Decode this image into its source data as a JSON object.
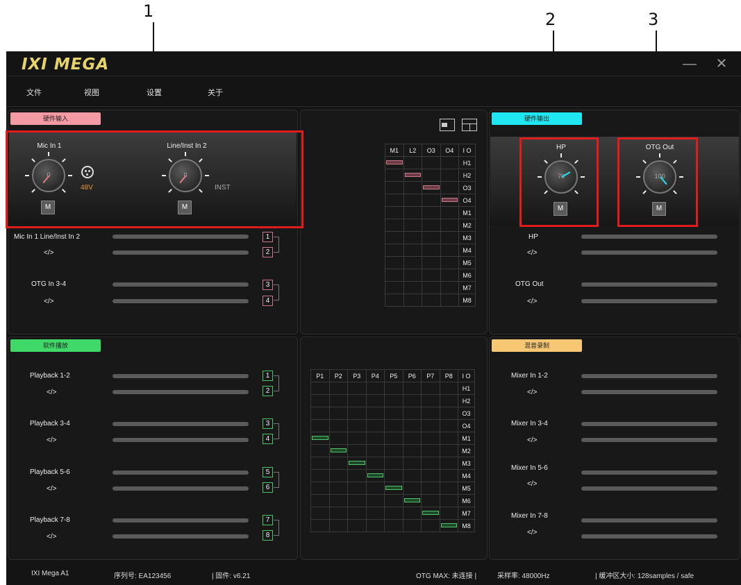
{
  "callouts": [
    "1",
    "2",
    "3"
  ],
  "app": {
    "logo": "IXI MEGA",
    "minimize": "—",
    "close": "✕"
  },
  "menu": {
    "file": "文件",
    "view": "视图",
    "settings": "设置",
    "about": "关于"
  },
  "hw_input": {
    "tag": "硬件输入",
    "tag_color": "#f49aa4",
    "mic": {
      "label": "Mic In 1",
      "value": "0",
      "phantom": "48V"
    },
    "line": {
      "label": "Line/Inst In 2",
      "value": "0",
      "inst": "INST"
    },
    "mute": "M",
    "rows": [
      {
        "name": "Mic In 1  Line/Inst In 2",
        "code": "</>",
        "nums": [
          "1",
          "2"
        ]
      },
      {
        "name": "OTG In 3-4",
        "code": "</>",
        "nums": [
          "3",
          "4"
        ]
      }
    ]
  },
  "hw_output": {
    "tag": "硬件输出",
    "tag_color": "#1fe6f0",
    "hp": {
      "label": "HP",
      "value": "70"
    },
    "otg": {
      "label": "OTG Out",
      "value": "100"
    },
    "mute": "M",
    "rows": [
      {
        "name": "HP",
        "code": "</>"
      },
      {
        "name": "OTG Out",
        "code": "</>"
      }
    ]
  },
  "sw_playback": {
    "tag": "软件播放",
    "tag_color": "#3fd96a",
    "rows": [
      {
        "name": "Playback 1-2",
        "code": "</>",
        "nums": [
          "1",
          "2"
        ]
      },
      {
        "name": "Playback 3-4",
        "code": "</>",
        "nums": [
          "3",
          "4"
        ]
      },
      {
        "name": "Playback 5-6",
        "code": "</>",
        "nums": [
          "5",
          "6"
        ]
      },
      {
        "name": "Playback 7-8",
        "code": "</>",
        "nums": [
          "7",
          "8"
        ]
      }
    ]
  },
  "mix_record": {
    "tag": "混音录制",
    "tag_color": "#f7c774",
    "rows": [
      {
        "name": "Mixer In 1-2",
        "code": "</>"
      },
      {
        "name": "Mixer In 3-4",
        "code": "</>"
      },
      {
        "name": "Mixer In 5-6",
        "code": "</>"
      },
      {
        "name": "Mixer In 7-8",
        "code": "</>"
      }
    ]
  },
  "matrix_top": {
    "cols": [
      "M1",
      "L2",
      "O3",
      "O4"
    ],
    "corner": "I O",
    "rows": [
      "H1",
      "H2",
      "O3",
      "O4",
      "M1",
      "M2",
      "M3",
      "M4",
      "M5",
      "M6",
      "M7",
      "M8"
    ],
    "routes": [
      [
        0,
        0
      ],
      [
        1,
        1
      ],
      [
        2,
        2
      ],
      [
        3,
        3
      ]
    ]
  },
  "matrix_bottom": {
    "cols": [
      "P1",
      "P2",
      "P3",
      "P4",
      "P5",
      "P6",
      "P7",
      "P8"
    ],
    "corner": "I O",
    "rows": [
      "H1",
      "H2",
      "O3",
      "O4",
      "M1",
      "M2",
      "M3",
      "M4",
      "M5",
      "M6",
      "M7",
      "M8"
    ],
    "routes": [
      [
        0,
        4
      ],
      [
        1,
        5
      ],
      [
        2,
        6
      ],
      [
        3,
        7
      ],
      [
        4,
        8
      ],
      [
        5,
        9
      ],
      [
        6,
        10
      ],
      [
        7,
        11
      ]
    ]
  },
  "status": {
    "device": "IXI Mega A1",
    "serial": "序列号: EA123456",
    "firmware": "| 固件: v6.21",
    "otg": "OTG MAX: 未连接 |",
    "rate": "采样率: 48000Hz",
    "buffer": "| 缓冲区大小: 128samples / safe"
  }
}
